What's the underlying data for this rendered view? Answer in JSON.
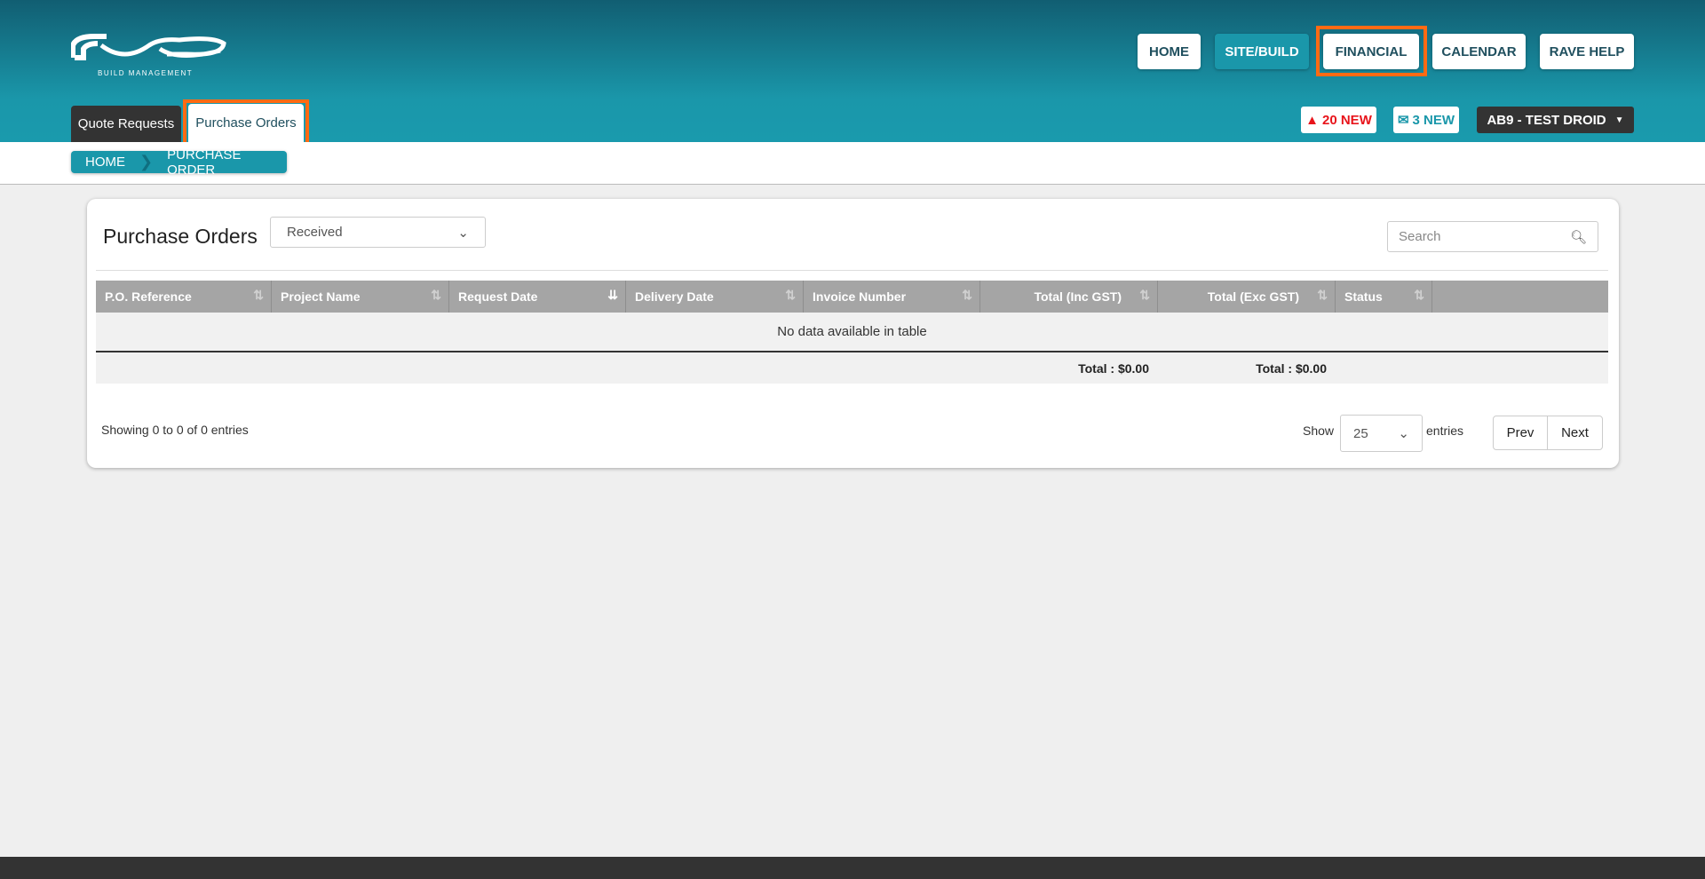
{
  "brand": {
    "logo_text": "rave",
    "tagline": "BUILD MANAGEMENT"
  },
  "nav": [
    {
      "label": "HOME"
    },
    {
      "label": "SITE/BUILD"
    },
    {
      "label": "FINANCIAL"
    },
    {
      "label": "CALENDAR"
    },
    {
      "label": "RAVE HELP"
    }
  ],
  "tabs": [
    {
      "label": "Quote Requests"
    },
    {
      "label": "Purchase Orders"
    }
  ],
  "alerts": {
    "warnings": "20 NEW",
    "messages": "3 NEW",
    "user": "AB9 - TEST DROID"
  },
  "breadcrumb": [
    "HOME",
    "PURCHASE ORDER"
  ],
  "page": {
    "title": "Purchase Orders",
    "filter_value": "Received",
    "search_placeholder": "Search"
  },
  "table": {
    "columns": [
      "P.O. Reference",
      "Project Name",
      "Request Date",
      "Delivery Date",
      "Invoice Number",
      "Total (Inc GST)",
      "Total (Exc GST)",
      "Status"
    ],
    "empty_message": "No data available in table",
    "footer_inc": "Total : $0.00",
    "footer_exc": "Total : $0.00"
  },
  "pagination": {
    "info": "Showing 0 to 0 of 0 entries",
    "show_label": "Show",
    "page_size": "25",
    "entries_label": "entries",
    "prev": "Prev",
    "next": "Next"
  },
  "colors": {
    "header": "#1a97aa",
    "highlight": "#ff6a13",
    "alert": "#e8141b"
  }
}
